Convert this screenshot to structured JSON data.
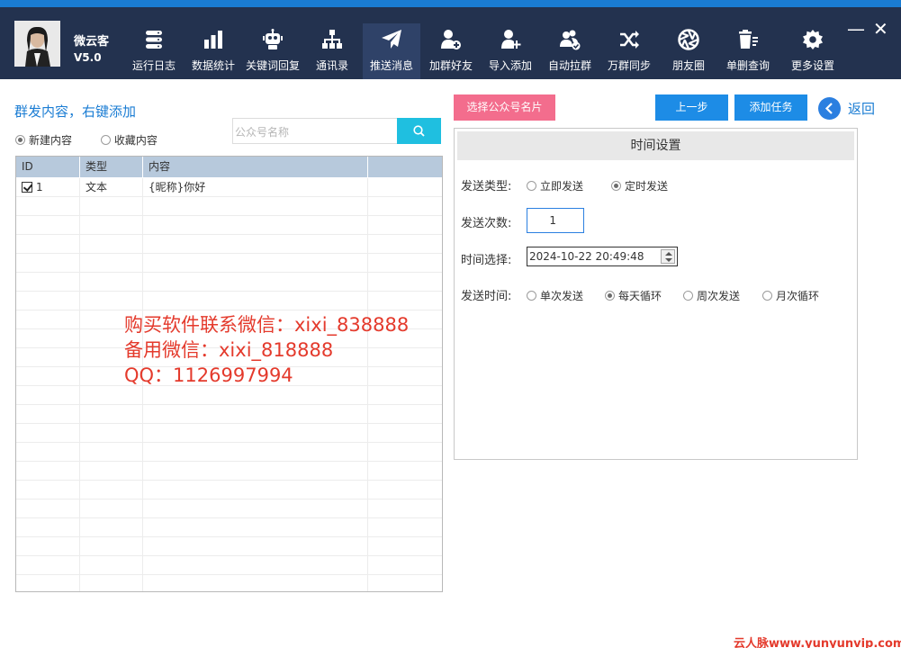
{
  "app": {
    "name": "微云客",
    "version": "V5.0"
  },
  "nav": [
    {
      "label": "运行日志",
      "icon": "database-icon"
    },
    {
      "label": "数据统计",
      "icon": "bar-chart-icon"
    },
    {
      "label": "关键词回复",
      "icon": "robot-icon"
    },
    {
      "label": "通讯录",
      "icon": "org-chart-icon"
    },
    {
      "label": "推送消息",
      "icon": "paper-plane-icon"
    },
    {
      "label": "加群好友",
      "icon": "user-add-icon"
    },
    {
      "label": "导入添加",
      "icon": "user-plus-icon"
    },
    {
      "label": "自动拉群",
      "icon": "group-check-icon"
    },
    {
      "label": "万群同步",
      "icon": "shuffle-icon"
    },
    {
      "label": "朋友圈",
      "icon": "aperture-icon"
    },
    {
      "label": "单删查询",
      "icon": "trash-icon"
    },
    {
      "label": "更多设置",
      "icon": "gear-icon"
    }
  ],
  "window": {
    "minimize": "—",
    "close": "✕"
  },
  "left": {
    "title": "群发内容，右键添加",
    "radio_new": "新建内容",
    "radio_fav": "收藏内容",
    "search_placeholder": "公众号名称",
    "table": {
      "headers": {
        "id": "ID",
        "type": "类型",
        "content": "内容"
      },
      "rows": [
        {
          "id": "1",
          "type": "文本",
          "content": "{昵称}你好"
        }
      ]
    }
  },
  "watermark": {
    "line1": "购买软件联系微信：xixi_838888",
    "line2": "备用微信：xixi_818888",
    "line3": "QQ：1126997994"
  },
  "right": {
    "select_button": "选择公众号名片",
    "prev_button": "上一步",
    "add_task_button": "添加任务",
    "back_label": "返回",
    "time_settings": {
      "title": "时间设置",
      "send_type_label": "发送类型:",
      "send_type_options": [
        "立即发送",
        "定时发送"
      ],
      "send_count_label": "发送次数:",
      "send_count_value": "1",
      "time_select_label": "时间选择:",
      "time_value": "2024-10-22 20:49:48",
      "send_time_label": "发送时间:",
      "send_time_options": [
        "单次发送",
        "每天循环",
        "周次发送",
        "月次循环"
      ]
    }
  },
  "corner_watermark": "云人脉www.yunyunvip.com"
}
